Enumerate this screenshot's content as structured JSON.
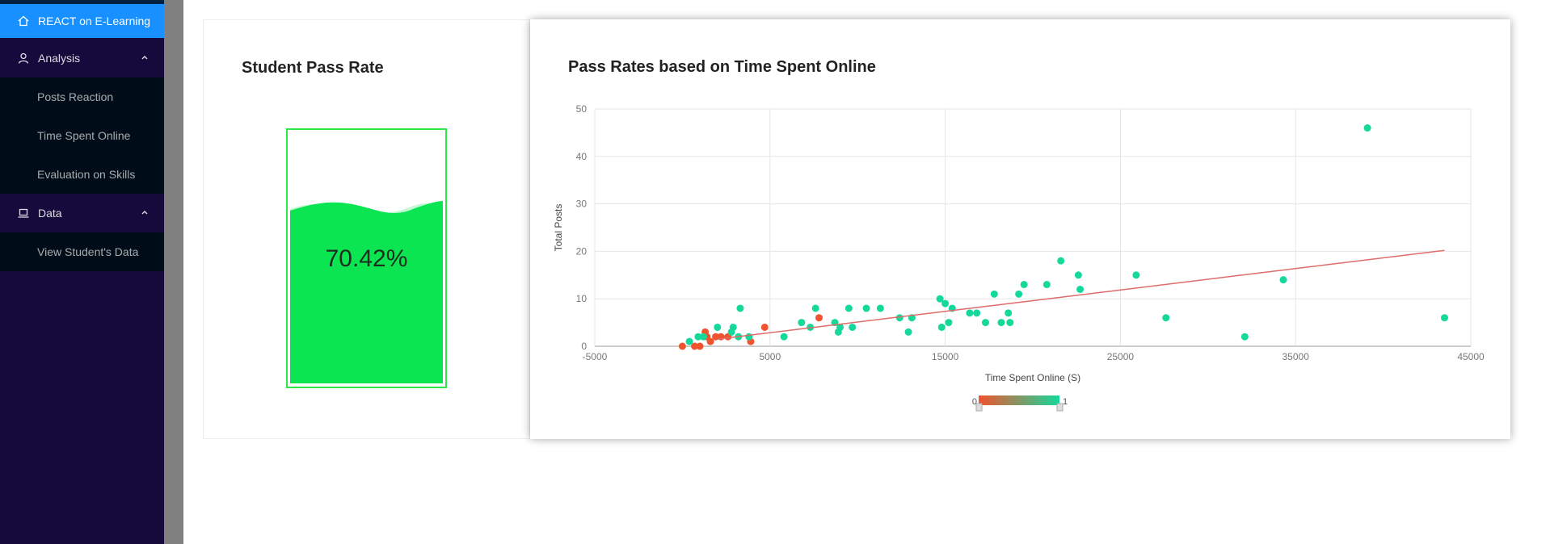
{
  "sidebar": {
    "brand": {
      "label": "REACT on E-Learning",
      "icon": "home-icon"
    },
    "groups": [
      {
        "label": "Analysis",
        "icon": "user-icon",
        "items": [
          "Posts Reaction",
          "Time Spent Online",
          "Evaluation on Skills"
        ]
      },
      {
        "label": "Data",
        "icon": "laptop-icon",
        "items": [
          "View Student's Data"
        ]
      }
    ]
  },
  "pass_rate_card": {
    "title": "Student Pass Rate",
    "value": "70.42%",
    "fill_fraction": 0.7042,
    "color": "#0be551"
  },
  "scatter_card": {
    "title": "Pass Rates based on Time Spent Online",
    "visualmap": {
      "min_label": "0",
      "max_label": "1",
      "low_color": "#f0542e",
      "high_color": "#14d99b"
    }
  },
  "chart_data": {
    "type": "scatter",
    "title": "Pass Rates based on Time Spent Online",
    "xlabel": "Time Spent Online (S)",
    "ylabel": "Total Posts",
    "xlim": [
      -5000,
      45000
    ],
    "ylim": [
      0,
      50
    ],
    "xticks": [
      "-5000",
      "5000",
      "15000",
      "25000",
      "35000",
      "45000"
    ],
    "yticks": [
      "0",
      "10",
      "20",
      "30",
      "40",
      "50"
    ],
    "grid": true,
    "trendline": {
      "x": [
        2000,
        43500
      ],
      "y": [
        1.5,
        20.2
      ],
      "color": "#e06a6a"
    },
    "series": [
      {
        "name": "0",
        "color": "#f0542e",
        "points": [
          [
            0,
            0
          ],
          [
            700,
            0
          ],
          [
            1000,
            0
          ],
          [
            1400,
            2
          ],
          [
            1600,
            1
          ],
          [
            1300,
            3
          ],
          [
            1900,
            2
          ],
          [
            2200,
            2
          ],
          [
            2600,
            2
          ],
          [
            3900,
            1
          ],
          [
            4700,
            4
          ],
          [
            7800,
            6
          ]
        ]
      },
      {
        "name": "1",
        "color": "#14d99b",
        "points": [
          [
            400,
            1
          ],
          [
            900,
            2
          ],
          [
            1200,
            2
          ],
          [
            2000,
            4
          ],
          [
            2800,
            3
          ],
          [
            2900,
            4
          ],
          [
            3200,
            2
          ],
          [
            3300,
            8
          ],
          [
            3800,
            2
          ],
          [
            5800,
            2
          ],
          [
            6800,
            5
          ],
          [
            7300,
            4
          ],
          [
            7600,
            8
          ],
          [
            8700,
            5
          ],
          [
            8900,
            3
          ],
          [
            9000,
            4
          ],
          [
            9500,
            8
          ],
          [
            9700,
            4
          ],
          [
            10500,
            8
          ],
          [
            11300,
            8
          ],
          [
            12400,
            6
          ],
          [
            12900,
            3
          ],
          [
            13100,
            6
          ],
          [
            14700,
            10
          ],
          [
            14800,
            4
          ],
          [
            15000,
            9
          ],
          [
            15200,
            5
          ],
          [
            15400,
            8
          ],
          [
            16400,
            7
          ],
          [
            16800,
            7
          ],
          [
            17300,
            5
          ],
          [
            17800,
            11
          ],
          [
            18200,
            5
          ],
          [
            18700,
            5
          ],
          [
            18600,
            7
          ],
          [
            19200,
            11
          ],
          [
            19500,
            13
          ],
          [
            20800,
            13
          ],
          [
            21600,
            18
          ],
          [
            22600,
            15
          ],
          [
            22700,
            12
          ],
          [
            25900,
            15
          ],
          [
            27600,
            6
          ],
          [
            32100,
            2
          ],
          [
            34300,
            14
          ],
          [
            39100,
            46
          ],
          [
            43500,
            6
          ]
        ]
      }
    ]
  }
}
